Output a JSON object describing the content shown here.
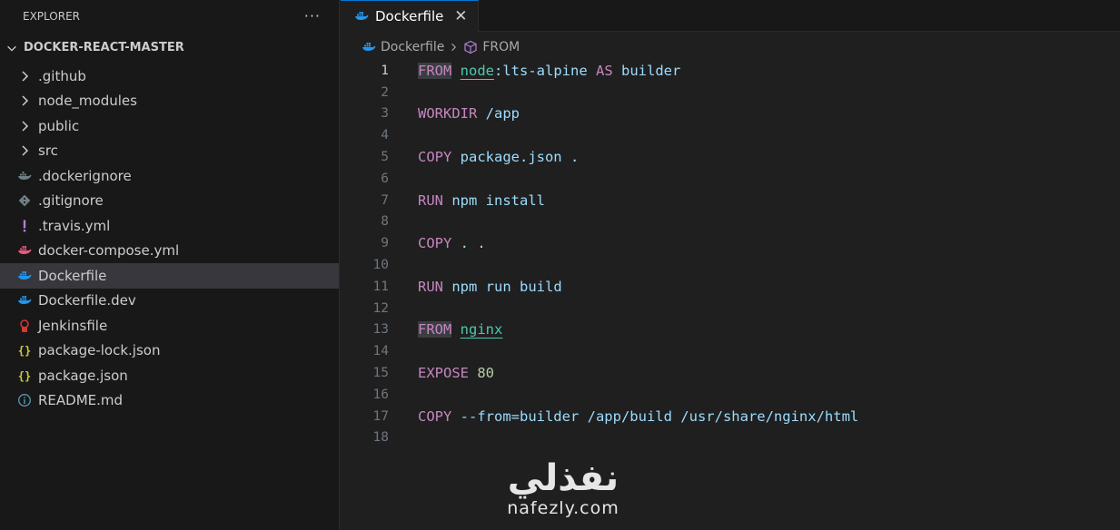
{
  "explorer": {
    "title": "EXPLORER",
    "more": "···",
    "project": "DOCKER-REACT-MASTER",
    "items": [
      {
        "label": ".github",
        "icon": "chevron-right-icon",
        "type": "folder"
      },
      {
        "label": "node_modules",
        "icon": "chevron-right-icon",
        "type": "folder"
      },
      {
        "label": "public",
        "icon": "chevron-right-icon",
        "type": "folder"
      },
      {
        "label": "src",
        "icon": "chevron-right-icon",
        "type": "folder"
      },
      {
        "label": ".dockerignore",
        "icon": "docker-gray-icon",
        "type": "file"
      },
      {
        "label": ".gitignore",
        "icon": "git-icon",
        "type": "file"
      },
      {
        "label": ".travis.yml",
        "icon": "exclamation-icon",
        "type": "file"
      },
      {
        "label": "docker-compose.yml",
        "icon": "docker-compose-icon",
        "type": "file"
      },
      {
        "label": "Dockerfile",
        "icon": "docker-icon",
        "type": "file",
        "selected": true
      },
      {
        "label": "Dockerfile.dev",
        "icon": "docker-icon",
        "type": "file"
      },
      {
        "label": "Jenkinsfile",
        "icon": "jenkins-icon",
        "type": "file"
      },
      {
        "label": "package-lock.json",
        "icon": "json-braces-icon",
        "type": "file"
      },
      {
        "label": "package.json",
        "icon": "json-braces-icon",
        "type": "file"
      },
      {
        "label": "README.md",
        "icon": "info-icon",
        "type": "file"
      }
    ]
  },
  "tab": {
    "label": "Dockerfile",
    "close": "✕"
  },
  "breadcrumb": {
    "file": "Dockerfile",
    "symbol": "FROM"
  },
  "code": {
    "lines": [
      {
        "n": "1",
        "tokens": [
          {
            "t": "FROM",
            "c": "kw hl"
          },
          {
            "t": " "
          },
          {
            "t": "node",
            "c": "img"
          },
          {
            "t": ":lts-alpine ",
            "c": "plain"
          },
          {
            "t": "AS",
            "c": "kw"
          },
          {
            "t": " builder",
            "c": "plain"
          }
        ]
      },
      {
        "n": "2",
        "tokens": []
      },
      {
        "n": "3",
        "tokens": [
          {
            "t": "WORKDIR",
            "c": "kw"
          },
          {
            "t": " /app",
            "c": "plain"
          }
        ]
      },
      {
        "n": "4",
        "tokens": []
      },
      {
        "n": "5",
        "tokens": [
          {
            "t": "COPY",
            "c": "kw"
          },
          {
            "t": " package.json .",
            "c": "plain"
          }
        ]
      },
      {
        "n": "6",
        "tokens": []
      },
      {
        "n": "7",
        "tokens": [
          {
            "t": "RUN",
            "c": "kw"
          },
          {
            "t": " npm install",
            "c": "plain"
          }
        ]
      },
      {
        "n": "8",
        "tokens": []
      },
      {
        "n": "9",
        "tokens": [
          {
            "t": "COPY",
            "c": "kw"
          },
          {
            "t": " . .",
            "c": "plain"
          }
        ]
      },
      {
        "n": "10",
        "tokens": []
      },
      {
        "n": "11",
        "tokens": [
          {
            "t": "RUN",
            "c": "kw"
          },
          {
            "t": " npm run build",
            "c": "plain"
          }
        ]
      },
      {
        "n": "12",
        "tokens": []
      },
      {
        "n": "13",
        "tokens": [
          {
            "t": "FROM",
            "c": "kw hl"
          },
          {
            "t": " "
          },
          {
            "t": "nginx",
            "c": "img"
          }
        ]
      },
      {
        "n": "14",
        "tokens": []
      },
      {
        "n": "15",
        "tokens": [
          {
            "t": "EXPOSE",
            "c": "kw"
          },
          {
            "t": " "
          },
          {
            "t": "80",
            "c": "num"
          }
        ]
      },
      {
        "n": "16",
        "tokens": []
      },
      {
        "n": "17",
        "tokens": [
          {
            "t": "COPY",
            "c": "kw"
          },
          {
            "t": " --from=builder /app/build /usr/share/nginx/html",
            "c": "plain"
          }
        ]
      },
      {
        "n": "18",
        "tokens": []
      }
    ]
  },
  "watermark": {
    "arabic": "نفذلي",
    "latin": "nafezly.com"
  },
  "colors": {
    "accent": "#0078d4",
    "keyword": "#c586c0",
    "image": "#4ec9b0",
    "number": "#b5cea8",
    "text": "#9cdcfe"
  }
}
